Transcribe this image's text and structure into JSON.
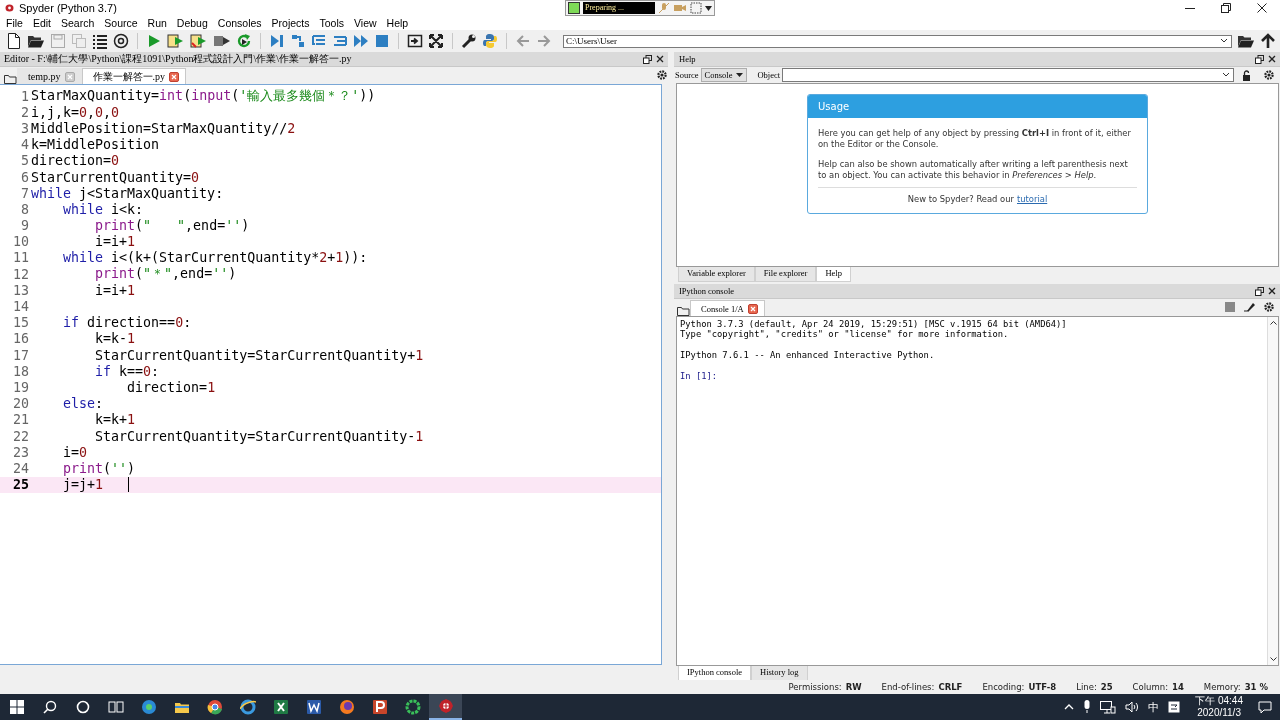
{
  "window": {
    "title": "Spyder (Python 3.7)"
  },
  "recorder": {
    "status": "Preparing ..."
  },
  "menu": [
    "File",
    "Edit",
    "Search",
    "Source",
    "Run",
    "Debug",
    "Consoles",
    "Projects",
    "Tools",
    "View",
    "Help"
  ],
  "toolbar": {
    "path": "C:\\Users\\User"
  },
  "editor": {
    "title": "Editor - F:\\輔仁大學\\Python\\課程1091\\Python程式設計入門\\作業\\作業一解答一.py",
    "tabs": [
      {
        "label": "temp.py",
        "selected": false
      },
      {
        "label": "作業一解答一.py",
        "selected": true
      }
    ],
    "lines": [
      {
        "number": "1",
        "current": false,
        "tokens": [
          {
            "kind": "plain",
            "text": "StarMaxQuantity="
          },
          {
            "kind": "builtin",
            "text": "int"
          },
          {
            "kind": "plain",
            "text": "("
          },
          {
            "kind": "builtin",
            "text": "input"
          },
          {
            "kind": "plain",
            "text": "("
          },
          {
            "kind": "string",
            "text": "'輸入最多幾個＊？'"
          },
          {
            "kind": "plain",
            "text": "))"
          }
        ]
      },
      {
        "number": "2",
        "current": false,
        "tokens": [
          {
            "kind": "plain",
            "text": "i,j,k="
          },
          {
            "kind": "number",
            "text": "0"
          },
          {
            "kind": "plain",
            "text": ","
          },
          {
            "kind": "number",
            "text": "0"
          },
          {
            "kind": "plain",
            "text": ","
          },
          {
            "kind": "number",
            "text": "0"
          }
        ]
      },
      {
        "number": "3",
        "current": false,
        "tokens": [
          {
            "kind": "plain",
            "text": "MiddlePosition=StarMaxQuantity//"
          },
          {
            "kind": "number",
            "text": "2"
          }
        ]
      },
      {
        "number": "4",
        "current": false,
        "tokens": [
          {
            "kind": "plain",
            "text": "k=MiddlePosition"
          }
        ]
      },
      {
        "number": "5",
        "current": false,
        "tokens": [
          {
            "kind": "plain",
            "text": "direction="
          },
          {
            "kind": "number",
            "text": "0"
          }
        ]
      },
      {
        "number": "6",
        "current": false,
        "tokens": [
          {
            "kind": "plain",
            "text": "StarCurrentQuantity="
          },
          {
            "kind": "number",
            "text": "0"
          }
        ]
      },
      {
        "number": "7",
        "current": false,
        "tokens": [
          {
            "kind": "keyword",
            "text": "while"
          },
          {
            "kind": "plain",
            "text": " j<StarMaxQuantity:"
          }
        ]
      },
      {
        "number": "8",
        "current": false,
        "tokens": [
          {
            "kind": "keyword",
            "text": "    while"
          },
          {
            "kind": "plain",
            "text": " i<k:"
          }
        ]
      },
      {
        "number": "9",
        "current": false,
        "tokens": [
          {
            "kind": "builtin",
            "text": "        print"
          },
          {
            "kind": "plain",
            "text": "("
          },
          {
            "kind": "string",
            "text": "\"　　\""
          },
          {
            "kind": "plain",
            "text": ",end="
          },
          {
            "kind": "string",
            "text": "''"
          },
          {
            "kind": "plain",
            "text": ")"
          }
        ]
      },
      {
        "number": "10",
        "current": false,
        "tokens": [
          {
            "kind": "plain",
            "text": "        i=i+"
          },
          {
            "kind": "number",
            "text": "1"
          }
        ]
      },
      {
        "number": "11",
        "current": false,
        "tokens": [
          {
            "kind": "keyword",
            "text": "    while"
          },
          {
            "kind": "plain",
            "text": " i<(k+(StarCurrentQuantity*"
          },
          {
            "kind": "number",
            "text": "2"
          },
          {
            "kind": "plain",
            "text": "+"
          },
          {
            "kind": "number",
            "text": "1"
          },
          {
            "kind": "plain",
            "text": ")):"
          }
        ]
      },
      {
        "number": "12",
        "current": false,
        "tokens": [
          {
            "kind": "builtin",
            "text": "        print"
          },
          {
            "kind": "plain",
            "text": "("
          },
          {
            "kind": "string",
            "text": "\"＊\""
          },
          {
            "kind": "plain",
            "text": ",end="
          },
          {
            "kind": "string",
            "text": "''"
          },
          {
            "kind": "plain",
            "text": ")"
          }
        ]
      },
      {
        "number": "13",
        "current": false,
        "tokens": [
          {
            "kind": "plain",
            "text": "        i=i+"
          },
          {
            "kind": "number",
            "text": "1"
          }
        ]
      },
      {
        "number": "14",
        "current": false
      },
      {
        "number": "15",
        "current": false,
        "tokens": [
          {
            "kind": "keyword",
            "text": "    if"
          },
          {
            "kind": "plain",
            "text": " direction=="
          },
          {
            "kind": "number",
            "text": "0"
          },
          {
            "kind": "plain",
            "text": ":"
          }
        ]
      },
      {
        "number": "16",
        "current": false,
        "tokens": [
          {
            "kind": "plain",
            "text": "        k=k-"
          },
          {
            "kind": "number",
            "text": "1"
          }
        ]
      },
      {
        "number": "17",
        "current": false,
        "tokens": [
          {
            "kind": "plain",
            "text": "        StarCurrentQuantity=StarCurrentQuantity+"
          },
          {
            "kind": "number",
            "text": "1"
          }
        ]
      },
      {
        "number": "18",
        "current": false,
        "tokens": [
          {
            "kind": "keyword",
            "text": "        if"
          },
          {
            "kind": "plain",
            "text": " k=="
          },
          {
            "kind": "number",
            "text": "0"
          },
          {
            "kind": "plain",
            "text": ":"
          }
        ]
      },
      {
        "number": "19",
        "current": false,
        "tokens": [
          {
            "kind": "plain",
            "text": "            direction="
          },
          {
            "kind": "number",
            "text": "1"
          }
        ]
      },
      {
        "number": "20",
        "current": false,
        "tokens": [
          {
            "kind": "keyword",
            "text": "    else"
          },
          {
            "kind": "plain",
            "text": ":"
          }
        ]
      },
      {
        "number": "21",
        "current": false,
        "tokens": [
          {
            "kind": "plain",
            "text": "        k=k+"
          },
          {
            "kind": "number",
            "text": "1"
          }
        ]
      },
      {
        "number": "22",
        "current": false,
        "tokens": [
          {
            "kind": "plain",
            "text": "        StarCurrentQuantity=StarCurrentQuantity-"
          },
          {
            "kind": "number",
            "text": "1"
          }
        ]
      },
      {
        "number": "23",
        "current": false,
        "tokens": [
          {
            "kind": "plain",
            "text": "    i="
          },
          {
            "kind": "number",
            "text": "0"
          }
        ]
      },
      {
        "number": "24",
        "current": false,
        "tokens": [
          {
            "kind": "builtin",
            "text": "    print"
          },
          {
            "kind": "plain",
            "text": "("
          },
          {
            "kind": "string",
            "text": "''"
          },
          {
            "kind": "plain",
            "text": ")"
          }
        ]
      },
      {
        "number": "25",
        "current": true,
        "tokens": [
          {
            "kind": "plain",
            "text": "    j=j+"
          },
          {
            "kind": "number",
            "text": "1"
          }
        ]
      }
    ]
  },
  "help": {
    "title": "Help",
    "source_label": "Source",
    "source": "Console",
    "object_label": "Object",
    "usage": {
      "heading": "Usage",
      "paragraphs": [
        "Here you can get help of any object by pressing **Ctrl+I** in front of it, either on the Editor or the Console.",
        "Help can also be shown automatically after writing a left parenthesis next to an object. You can activate this behavior in *Preferences > Help*."
      ],
      "footer": "New to Spyder? Read our",
      "link": "tutorial"
    },
    "tabs": [
      {
        "label": "Variable explorer",
        "selected": false
      },
      {
        "label": "File explorer",
        "selected": false
      },
      {
        "label": "Help",
        "selected": true
      }
    ]
  },
  "console": {
    "title": "IPython console",
    "tabs": [
      {
        "label": "Console 1/A",
        "selected": true
      }
    ],
    "output": [
      [
        "Python 3.7.3 (default, Apr 24 2019, 15:29:51) [MSC v.1915 64 bit (AMD64)]",
        "Type \"copyright\", \"credits\" or \"license\" for more information."
      ],
      [
        "IPython 7.6.1 -- An enhanced Interactive Python."
      ]
    ],
    "prompt": "In [1]:",
    "bottom_tabs": [
      {
        "label": "IPython console",
        "selected": true
      },
      {
        "label": "History log",
        "selected": false
      }
    ]
  },
  "status_bar": [
    {
      "label": "Permissions:",
      "value": "RW"
    },
    {
      "label": "End-of-lines:",
      "value": "CRLF"
    },
    {
      "label": "Encoding:",
      "value": "UTF-8"
    },
    {
      "label": "Line:",
      "value": "25"
    },
    {
      "label": "Column:",
      "value": "14"
    },
    {
      "label": "Memory:",
      "value": "31 %"
    }
  ],
  "taskbar": {
    "ime": "中",
    "time": "下午 04:44",
    "date": "2020/11/3"
  }
}
